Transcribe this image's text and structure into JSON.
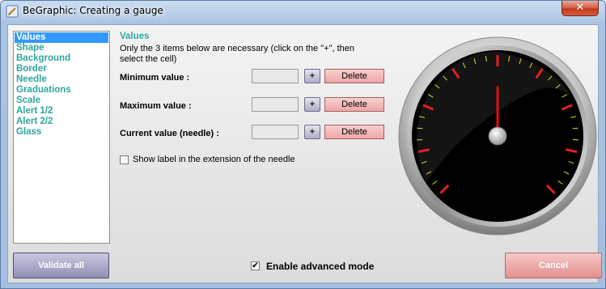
{
  "window": {
    "title": "BeGraphic: Creating a gauge",
    "title_icon": "pen-icon",
    "close_glyph": "✕"
  },
  "sidebar": {
    "items": [
      {
        "label": "Values",
        "selected": true
      },
      {
        "label": "Shape"
      },
      {
        "label": "Background"
      },
      {
        "label": "Border"
      },
      {
        "label": "Needle"
      },
      {
        "label": "Graduations"
      },
      {
        "label": "Scale"
      },
      {
        "label": "Alert  1/2"
      },
      {
        "label": "Alert  2/2"
      },
      {
        "label": "Glass"
      }
    ]
  },
  "panel": {
    "title": "Values",
    "description": "Only the 3 items below are necessary (click on the \"+\", then select the cell)",
    "rows": [
      {
        "label": "Minimum value :",
        "value": "",
        "plus": "+",
        "delete": "Delete"
      },
      {
        "label": "Maximum value :",
        "value": "",
        "plus": "+",
        "delete": "Delete"
      },
      {
        "label": "Current value (needle) :",
        "value": "",
        "plus": "+",
        "delete": "Delete"
      }
    ],
    "show_label_checkbox": {
      "label": "Show label in the extension of the needle",
      "checked": false
    }
  },
  "footer": {
    "validate_label": "Validate all",
    "advanced_mode": {
      "label": "Enable advanced mode",
      "checked": true,
      "check_glyph": "✔"
    },
    "cancel_label": "Cancel"
  },
  "gauge": {
    "needle_value": 0.5,
    "colors": {
      "face": "#000000",
      "rim": "#c8c8c8",
      "major_tick": "#e02020",
      "minor_tick": "#e8d81a",
      "needle": "#e01010",
      "hub": "#bdbdbd"
    }
  }
}
